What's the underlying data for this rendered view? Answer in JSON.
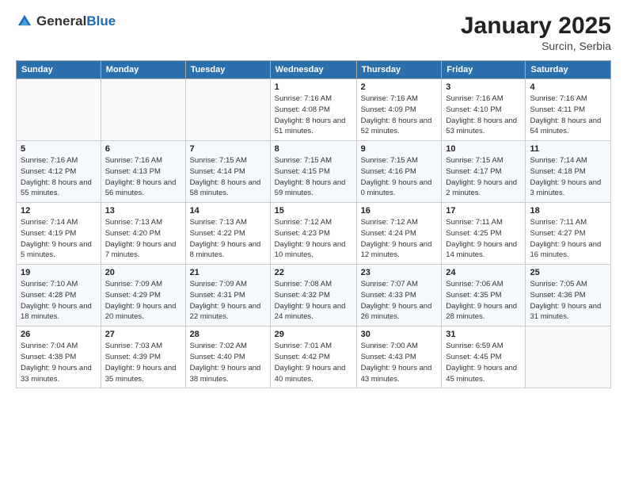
{
  "header": {
    "logo_general": "General",
    "logo_blue": "Blue",
    "month_title": "January 2025",
    "subtitle": "Surcin, Serbia"
  },
  "days_of_week": [
    "Sunday",
    "Monday",
    "Tuesday",
    "Wednesday",
    "Thursday",
    "Friday",
    "Saturday"
  ],
  "weeks": [
    [
      {
        "day": "",
        "info": ""
      },
      {
        "day": "",
        "info": ""
      },
      {
        "day": "",
        "info": ""
      },
      {
        "day": "1",
        "info": "Sunrise: 7:16 AM\nSunset: 4:08 PM\nDaylight: 8 hours and 51 minutes."
      },
      {
        "day": "2",
        "info": "Sunrise: 7:16 AM\nSunset: 4:09 PM\nDaylight: 8 hours and 52 minutes."
      },
      {
        "day": "3",
        "info": "Sunrise: 7:16 AM\nSunset: 4:10 PM\nDaylight: 8 hours and 53 minutes."
      },
      {
        "day": "4",
        "info": "Sunrise: 7:16 AM\nSunset: 4:11 PM\nDaylight: 8 hours and 54 minutes."
      }
    ],
    [
      {
        "day": "5",
        "info": "Sunrise: 7:16 AM\nSunset: 4:12 PM\nDaylight: 8 hours and 55 minutes."
      },
      {
        "day": "6",
        "info": "Sunrise: 7:16 AM\nSunset: 4:13 PM\nDaylight: 8 hours and 56 minutes."
      },
      {
        "day": "7",
        "info": "Sunrise: 7:15 AM\nSunset: 4:14 PM\nDaylight: 8 hours and 58 minutes."
      },
      {
        "day": "8",
        "info": "Sunrise: 7:15 AM\nSunset: 4:15 PM\nDaylight: 8 hours and 59 minutes."
      },
      {
        "day": "9",
        "info": "Sunrise: 7:15 AM\nSunset: 4:16 PM\nDaylight: 9 hours and 0 minutes."
      },
      {
        "day": "10",
        "info": "Sunrise: 7:15 AM\nSunset: 4:17 PM\nDaylight: 9 hours and 2 minutes."
      },
      {
        "day": "11",
        "info": "Sunrise: 7:14 AM\nSunset: 4:18 PM\nDaylight: 9 hours and 3 minutes."
      }
    ],
    [
      {
        "day": "12",
        "info": "Sunrise: 7:14 AM\nSunset: 4:19 PM\nDaylight: 9 hours and 5 minutes."
      },
      {
        "day": "13",
        "info": "Sunrise: 7:13 AM\nSunset: 4:20 PM\nDaylight: 9 hours and 7 minutes."
      },
      {
        "day": "14",
        "info": "Sunrise: 7:13 AM\nSunset: 4:22 PM\nDaylight: 9 hours and 8 minutes."
      },
      {
        "day": "15",
        "info": "Sunrise: 7:12 AM\nSunset: 4:23 PM\nDaylight: 9 hours and 10 minutes."
      },
      {
        "day": "16",
        "info": "Sunrise: 7:12 AM\nSunset: 4:24 PM\nDaylight: 9 hours and 12 minutes."
      },
      {
        "day": "17",
        "info": "Sunrise: 7:11 AM\nSunset: 4:25 PM\nDaylight: 9 hours and 14 minutes."
      },
      {
        "day": "18",
        "info": "Sunrise: 7:11 AM\nSunset: 4:27 PM\nDaylight: 9 hours and 16 minutes."
      }
    ],
    [
      {
        "day": "19",
        "info": "Sunrise: 7:10 AM\nSunset: 4:28 PM\nDaylight: 9 hours and 18 minutes."
      },
      {
        "day": "20",
        "info": "Sunrise: 7:09 AM\nSunset: 4:29 PM\nDaylight: 9 hours and 20 minutes."
      },
      {
        "day": "21",
        "info": "Sunrise: 7:09 AM\nSunset: 4:31 PM\nDaylight: 9 hours and 22 minutes."
      },
      {
        "day": "22",
        "info": "Sunrise: 7:08 AM\nSunset: 4:32 PM\nDaylight: 9 hours and 24 minutes."
      },
      {
        "day": "23",
        "info": "Sunrise: 7:07 AM\nSunset: 4:33 PM\nDaylight: 9 hours and 26 minutes."
      },
      {
        "day": "24",
        "info": "Sunrise: 7:06 AM\nSunset: 4:35 PM\nDaylight: 9 hours and 28 minutes."
      },
      {
        "day": "25",
        "info": "Sunrise: 7:05 AM\nSunset: 4:36 PM\nDaylight: 9 hours and 31 minutes."
      }
    ],
    [
      {
        "day": "26",
        "info": "Sunrise: 7:04 AM\nSunset: 4:38 PM\nDaylight: 9 hours and 33 minutes."
      },
      {
        "day": "27",
        "info": "Sunrise: 7:03 AM\nSunset: 4:39 PM\nDaylight: 9 hours and 35 minutes."
      },
      {
        "day": "28",
        "info": "Sunrise: 7:02 AM\nSunset: 4:40 PM\nDaylight: 9 hours and 38 minutes."
      },
      {
        "day": "29",
        "info": "Sunrise: 7:01 AM\nSunset: 4:42 PM\nDaylight: 9 hours and 40 minutes."
      },
      {
        "day": "30",
        "info": "Sunrise: 7:00 AM\nSunset: 4:43 PM\nDaylight: 9 hours and 43 minutes."
      },
      {
        "day": "31",
        "info": "Sunrise: 6:59 AM\nSunset: 4:45 PM\nDaylight: 9 hours and 45 minutes."
      },
      {
        "day": "",
        "info": ""
      }
    ]
  ]
}
